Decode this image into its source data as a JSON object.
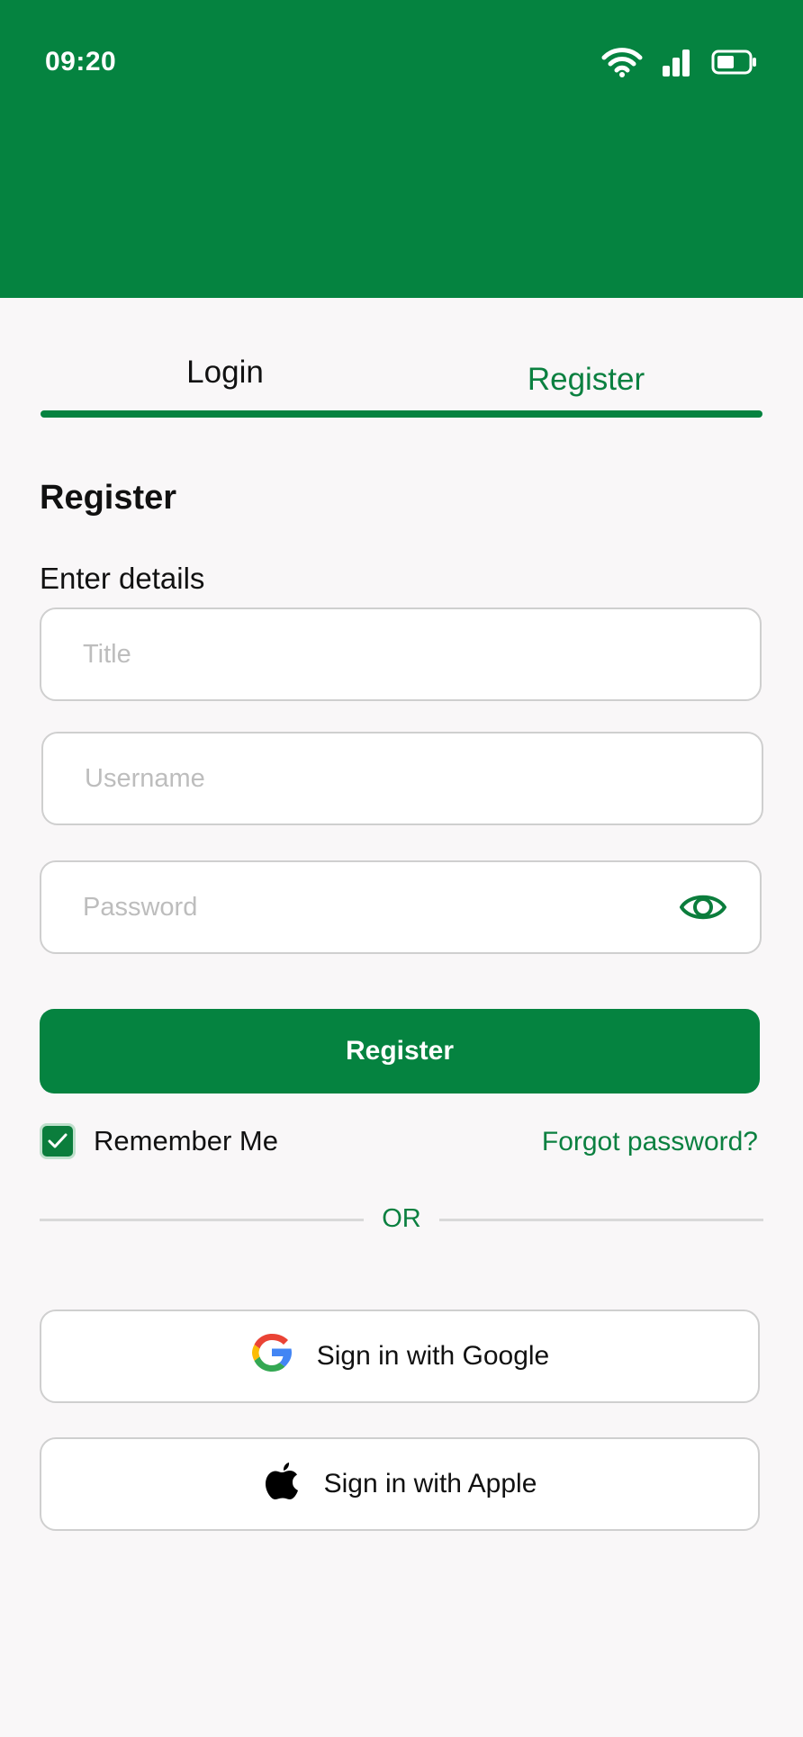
{
  "status_bar": {
    "time": "09:20"
  },
  "tabs": {
    "login": "Login",
    "register": "Register"
  },
  "form": {
    "title": "Register",
    "subtitle": "Enter details",
    "title_placeholder": "Title",
    "username_placeholder": "Username",
    "password_placeholder": "Password",
    "submit_label": "Register"
  },
  "options": {
    "remember_label": "Remember Me",
    "remember_checked": true,
    "forgot_label": "Forgot password?"
  },
  "divider": {
    "label": "OR"
  },
  "social": {
    "google_label": "Sign in with Google",
    "apple_label": "Sign in with Apple"
  },
  "colors": {
    "brand": "#058340",
    "background": "#f9f7f8",
    "border": "#cfcfcf"
  }
}
